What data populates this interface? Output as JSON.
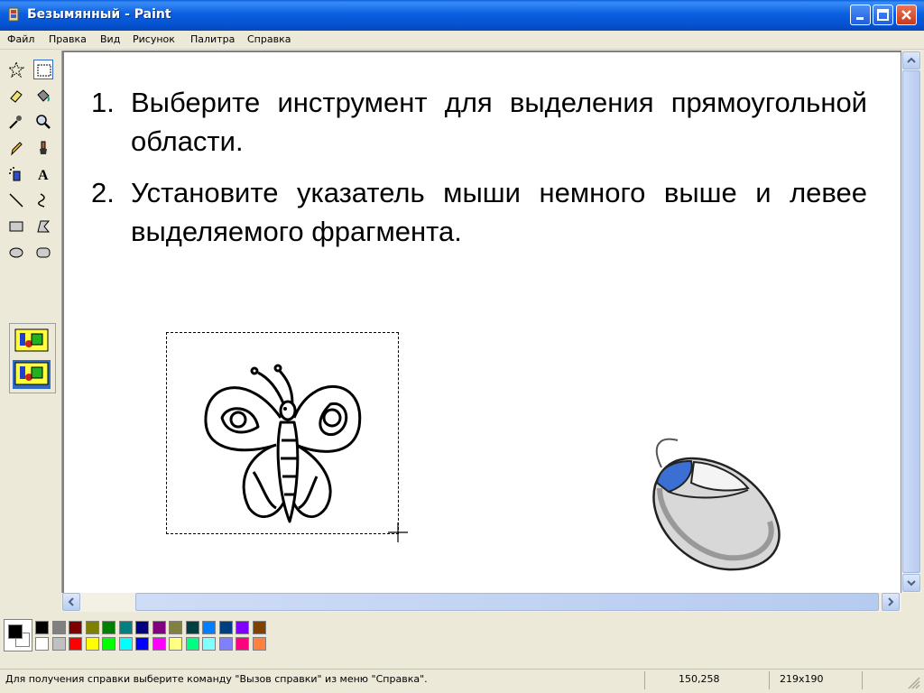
{
  "window": {
    "title": "Безымянный - Paint"
  },
  "menu": {
    "items": [
      "Файл",
      "Правка",
      "Вид",
      "Рисунок",
      "Палитра",
      "Справка"
    ]
  },
  "toolbox": {
    "tools": [
      "free-select-icon",
      "rect-select-icon",
      "eraser-icon",
      "fill-icon",
      "color-picker-icon",
      "magnifier-icon",
      "pencil-icon",
      "brush-icon",
      "airbrush-icon",
      "text-icon",
      "line-icon",
      "curve-icon",
      "rectangle-icon",
      "polygon-icon",
      "ellipse-icon",
      "rounded-rect-icon"
    ],
    "selected": "rect-select-icon"
  },
  "canvas": {
    "steps": [
      {
        "num": "1.",
        "text": "Выберите инструмент для выделения прямоугольной области."
      },
      {
        "num": "2.",
        "text": "Установите указатель мыши немного выше и левее выделяемого фрагмента."
      }
    ]
  },
  "palette": {
    "foreground": "#000000",
    "background": "#ffffff",
    "row1": [
      "#000000",
      "#808080",
      "#800000",
      "#808000",
      "#008000",
      "#008080",
      "#000080",
      "#800080",
      "#808040",
      "#004040",
      "#0080ff",
      "#004080",
      "#8000ff",
      "#804000"
    ],
    "row2": [
      "#ffffff",
      "#c0c0c0",
      "#ff0000",
      "#ffff00",
      "#00ff00",
      "#00ffff",
      "#0000ff",
      "#ff00ff",
      "#ffff80",
      "#00ff80",
      "#80ffff",
      "#8080ff",
      "#ff0080",
      "#ff8040"
    ]
  },
  "status": {
    "help": "Для получения справки выберите команду \"Вызов справки\" из меню \"Справка\".",
    "cursor": "150,258",
    "size": "219x190"
  },
  "colors": {
    "title_bar": "#0a5fe0",
    "selection": "#316ac5",
    "mouse_button": "#3b6fd4"
  }
}
